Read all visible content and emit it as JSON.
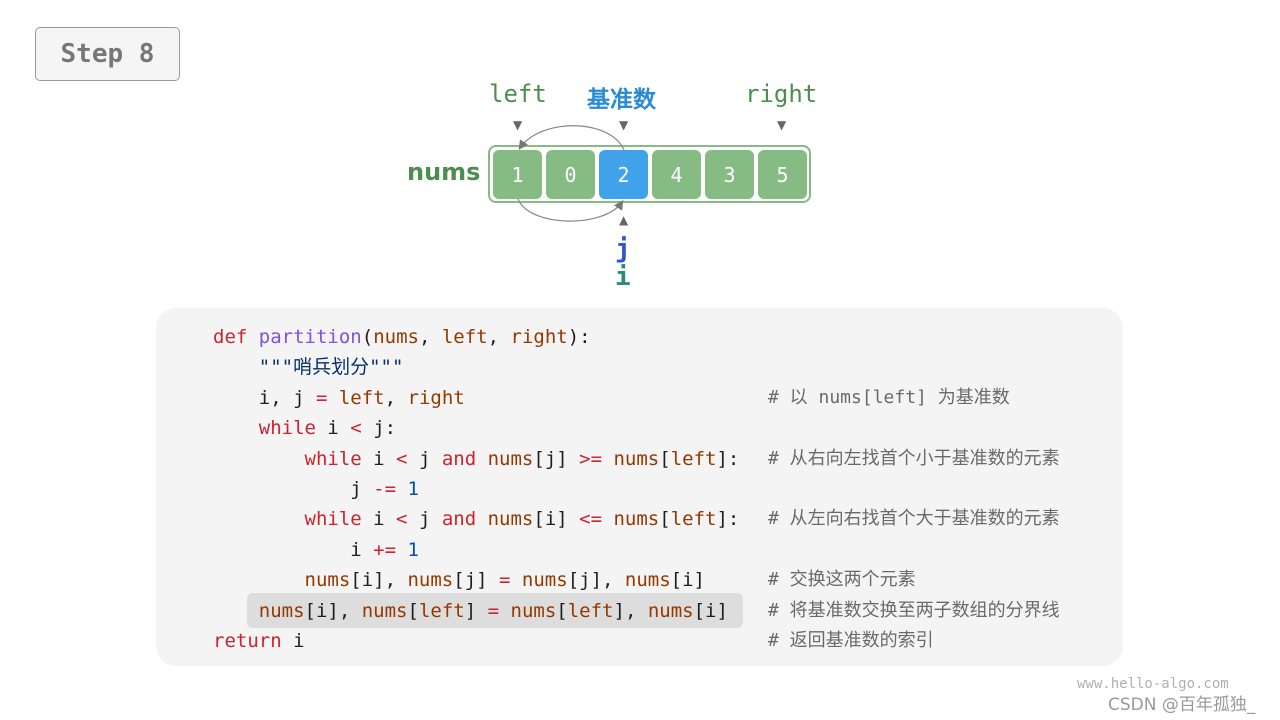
{
  "step": {
    "label": "Step 8"
  },
  "pointers": {
    "left": "left",
    "pivot": "基准数",
    "right": "right",
    "j": "j",
    "i": "i"
  },
  "array": {
    "label": "nums",
    "values": [
      "1",
      "0",
      "2",
      "4",
      "3",
      "5"
    ],
    "pivot_index": 2,
    "swap": {
      "from_index": 2,
      "to_index": 0
    }
  },
  "colors": {
    "cell": "#86bb84",
    "pivot_cell": "#40a2e8",
    "pointer_label": "#4b8f4f",
    "pivot_label": "#2a8bd4",
    "j_label": "#2f55d4",
    "i_label": "#2e8b77"
  },
  "code": {
    "highlighted_line": 9,
    "lines": [
      {
        "tokens": [
          [
            "kw",
            "def"
          ],
          [
            "pl",
            " "
          ],
          [
            "fn",
            "partition"
          ],
          [
            "pl",
            "("
          ],
          [
            "id",
            "nums"
          ],
          [
            "pl",
            ", "
          ],
          [
            "id",
            "left"
          ],
          [
            "pl",
            ", "
          ],
          [
            "id",
            "right"
          ],
          [
            "pl",
            "):"
          ]
        ],
        "comment": ""
      },
      {
        "tokens": [
          [
            "pl",
            "    "
          ],
          [
            "str",
            "\"\"\"哨兵划分\"\"\""
          ]
        ],
        "comment": ""
      },
      {
        "tokens": [
          [
            "pl",
            "    i, j "
          ],
          [
            "op",
            "="
          ],
          [
            "pl",
            " "
          ],
          [
            "id",
            "left"
          ],
          [
            "pl",
            ", "
          ],
          [
            "id",
            "right"
          ]
        ],
        "comment": "# 以 nums[left] 为基准数"
      },
      {
        "tokens": [
          [
            "pl",
            "    "
          ],
          [
            "kw",
            "while"
          ],
          [
            "pl",
            " i "
          ],
          [
            "op",
            "<"
          ],
          [
            "pl",
            " j:"
          ]
        ],
        "comment": ""
      },
      {
        "tokens": [
          [
            "pl",
            "        "
          ],
          [
            "kw",
            "while"
          ],
          [
            "pl",
            " i "
          ],
          [
            "op",
            "<"
          ],
          [
            "pl",
            " j "
          ],
          [
            "kw",
            "and"
          ],
          [
            "pl",
            " "
          ],
          [
            "id",
            "nums"
          ],
          [
            "pl",
            "[j] "
          ],
          [
            "op",
            ">="
          ],
          [
            "pl",
            " "
          ],
          [
            "id",
            "nums"
          ],
          [
            "pl",
            "["
          ],
          [
            "id",
            "left"
          ],
          [
            "pl",
            "]:"
          ]
        ],
        "comment": "# 从右向左找首个小于基准数的元素"
      },
      {
        "tokens": [
          [
            "pl",
            "            j "
          ],
          [
            "op",
            "-="
          ],
          [
            "pl",
            " "
          ],
          [
            "num",
            "1"
          ]
        ],
        "comment": ""
      },
      {
        "tokens": [
          [
            "pl",
            "        "
          ],
          [
            "kw",
            "while"
          ],
          [
            "pl",
            " i "
          ],
          [
            "op",
            "<"
          ],
          [
            "pl",
            " j "
          ],
          [
            "kw",
            "and"
          ],
          [
            "pl",
            " "
          ],
          [
            "id",
            "nums"
          ],
          [
            "pl",
            "[i] "
          ],
          [
            "op",
            "<="
          ],
          [
            "pl",
            " "
          ],
          [
            "id",
            "nums"
          ],
          [
            "pl",
            "["
          ],
          [
            "id",
            "left"
          ],
          [
            "pl",
            "]:"
          ]
        ],
        "comment": "# 从左向右找首个大于基准数的元素"
      },
      {
        "tokens": [
          [
            "pl",
            "            i "
          ],
          [
            "op",
            "+="
          ],
          [
            "pl",
            " "
          ],
          [
            "num",
            "1"
          ]
        ],
        "comment": ""
      },
      {
        "tokens": [
          [
            "pl",
            "        "
          ],
          [
            "id",
            "nums"
          ],
          [
            "pl",
            "[i], "
          ],
          [
            "id",
            "nums"
          ],
          [
            "pl",
            "[j] "
          ],
          [
            "op",
            "="
          ],
          [
            "pl",
            " "
          ],
          [
            "id",
            "nums"
          ],
          [
            "pl",
            "[j], "
          ],
          [
            "id",
            "nums"
          ],
          [
            "pl",
            "[i]"
          ]
        ],
        "comment": "# 交换这两个元素"
      },
      {
        "tokens": [
          [
            "pl",
            "    "
          ],
          [
            "id",
            "nums"
          ],
          [
            "pl",
            "[i], "
          ],
          [
            "id",
            "nums"
          ],
          [
            "pl",
            "["
          ],
          [
            "id",
            "left"
          ],
          [
            "pl",
            "] "
          ],
          [
            "op",
            "="
          ],
          [
            "pl",
            " "
          ],
          [
            "id",
            "nums"
          ],
          [
            "pl",
            "["
          ],
          [
            "id",
            "left"
          ],
          [
            "pl",
            "], "
          ],
          [
            "id",
            "nums"
          ],
          [
            "pl",
            "[i]"
          ]
        ],
        "comment": "# 将基准数交换至两子数组的分界线"
      },
      {
        "tokens": [
          [
            "kw",
            "return"
          ],
          [
            "pl",
            " i"
          ]
        ],
        "comment": "# 返回基准数的索引"
      }
    ]
  },
  "watermark": {
    "site": "www.hello-algo.com",
    "author": "CSDN @百年孤独_"
  }
}
